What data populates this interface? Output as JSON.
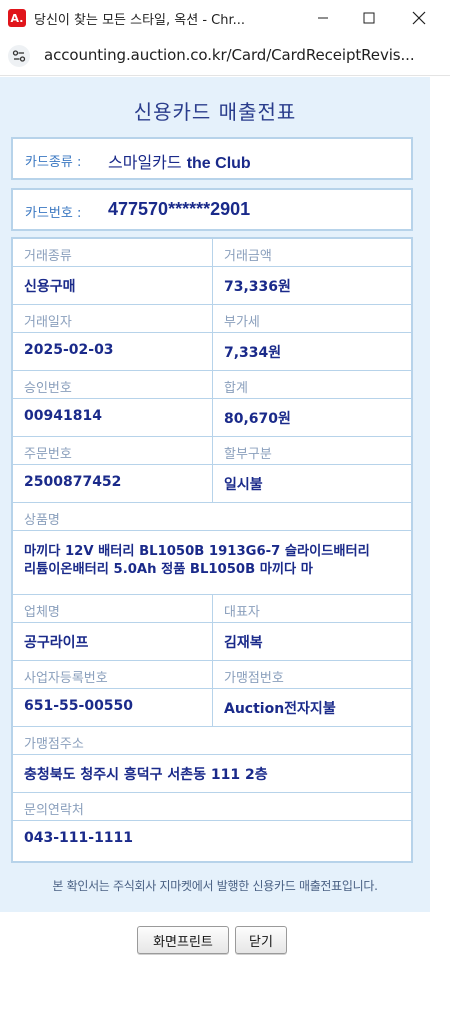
{
  "window": {
    "title": "당신이 찾는 모든 스타일, 옥션 - Chr...",
    "app_icon_letter": "A."
  },
  "address_bar": {
    "url": "accounting.auction.co.kr/Card/CardReceiptRevis..."
  },
  "receipt": {
    "title": "신용카드 매출전표",
    "card_type": {
      "label": "카드종류 :",
      "value_kr": "스마일카드 ",
      "value_en": "the Club"
    },
    "card_number": {
      "label": "카드번호 :",
      "value": "477570******2901"
    },
    "fields": {
      "transaction_type": {
        "label": "거래종류",
        "value": "신용구매"
      },
      "transaction_amount": {
        "label": "거래금액",
        "value": "73,336원"
      },
      "transaction_date": {
        "label": "거래일자",
        "value": "2025-02-03"
      },
      "vat": {
        "label": "부가세",
        "value": "7,334원"
      },
      "approval_number": {
        "label": "승인번호",
        "value": "00941814"
      },
      "total": {
        "label": "합계",
        "value": "80,670원"
      },
      "order_number": {
        "label": "주문번호",
        "value": "2500877452"
      },
      "installment": {
        "label": "할부구분",
        "value": "일시불"
      },
      "product_name": {
        "label": "상품명",
        "value": "마끼다 12V 배터리 BL1050B 1913G6-7 슬라이드배터리 리튬이온배터리 5.0Ah 정품 BL1050B 마끼다 마"
      },
      "company_name": {
        "label": "업체명",
        "value": "공구라이프"
      },
      "representative": {
        "label": "대표자",
        "value": "김재복"
      },
      "business_reg_number": {
        "label": "사업자등록번호",
        "value": "651-55-00550"
      },
      "merchant_number": {
        "label": "가맹점번호",
        "value": "Auction전자지불"
      },
      "merchant_address": {
        "label": "가맹점주소",
        "value": "충청북도 청주시 흥덕구 서촌동 111 2층"
      },
      "contact": {
        "label": "문의연락처",
        "value": "043-111-1111"
      }
    },
    "footnote": "본 확인서는 주식회사 지마켓에서 발행한 신용카드 매출전표입니다."
  },
  "buttons": {
    "print": "화면프린트",
    "close": "닫기"
  },
  "colors": {
    "background": "#e5f1fb",
    "title": "#2a3d8c",
    "value_text": "#1a2a8a",
    "label_text": "#8a9fbc",
    "border": "#b7d3ea",
    "brand_red": "#e0151b"
  }
}
